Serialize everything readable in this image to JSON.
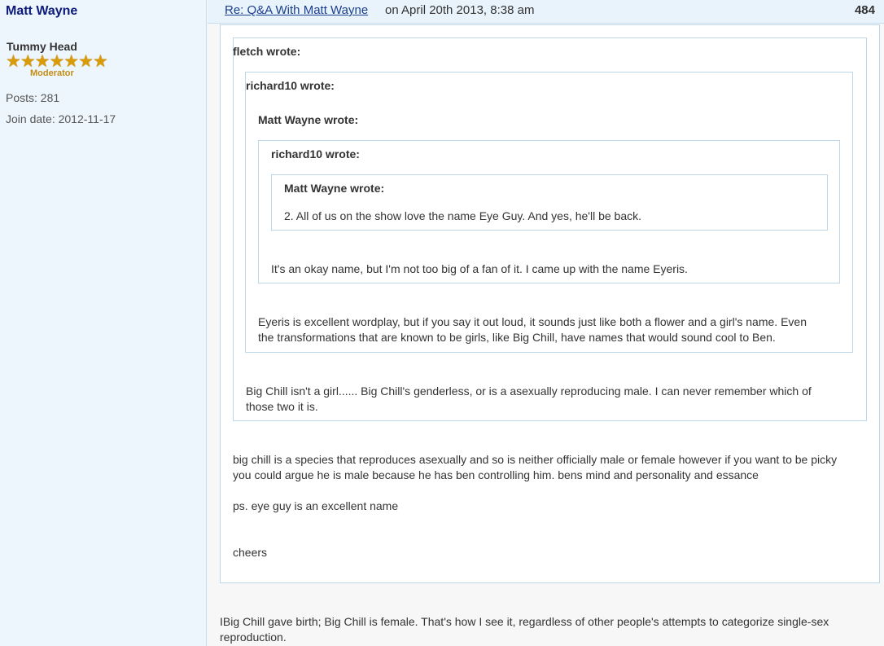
{
  "sidebar": {
    "username": "Matt Wayne",
    "rank_title": "Tummy Head",
    "stars": "★★★★★★★",
    "rank_label": "Moderator",
    "posts": "Posts: 281",
    "join_date": "Join date: 2012-11-17"
  },
  "post_header": {
    "title_link": "Re: Q&A With Matt Wayne",
    "date_text": "on April 20th 2013, 8:38 am",
    "post_number": "484"
  },
  "quotes": {
    "fletch": {
      "header": "fletch wrote:",
      "line1": "big chill is a species that reproduces asexually and so is neither officially male or female however if you want to be picky",
      "line2": "you could argue he is male because he has ben controlling him. bens mind and personality and essance",
      "line3": "ps. eye guy is an excellent name",
      "line4": "cheers"
    },
    "richard10_outer": {
      "header": "richard10 wrote:",
      "line1": "Big Chill isn't a girl...... Big Chill's genderless, or is a asexually reproducing male. I can never remember which of",
      "line2": "those two it is."
    },
    "matt_outer": {
      "header": "Matt Wayne wrote:",
      "line1": "Eyeris is excellent wordplay, but if you say it out loud, it sounds just like both a flower and a girl's name. Even",
      "line2": "the transformations that are known to be girls, like Big Chill, have names that would sound cool to Ben."
    },
    "richard10_inner": {
      "header": "richard10 wrote:",
      "line1": "It's an okay name, but I'm not too big of a fan of it. I came up with the name Eyeris."
    },
    "matt_inner": {
      "header": "Matt Wayne wrote:",
      "line1": "2. All of us on the show love the name Eye Guy. And yes, he'll be back."
    }
  },
  "reply": {
    "line1": "IBig Chill gave birth; Big Chill is female. That's how I see it, regardless of other people's attempts to categorize single-sex",
    "line2": "reproduction."
  }
}
